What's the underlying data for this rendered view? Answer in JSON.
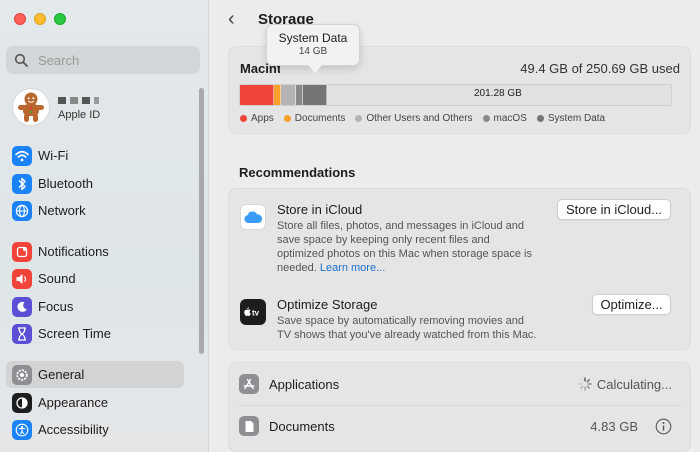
{
  "sidebar": {
    "search_placeholder": "Search",
    "account": {
      "subtitle": "Apple ID"
    },
    "items": [
      {
        "label": "Wi-Fi",
        "icon": "wifi-icon",
        "color": "#1a82fb"
      },
      {
        "label": "Bluetooth",
        "icon": "bluetooth-icon",
        "color": "#1a82fb"
      },
      {
        "label": "Network",
        "icon": "globe-icon",
        "color": "#1a82fb"
      },
      {
        "label": "Notifications",
        "icon": "bell-icon",
        "color": "#f04438"
      },
      {
        "label": "Sound",
        "icon": "speaker-icon",
        "color": "#f04438"
      },
      {
        "label": "Focus",
        "icon": "moon-icon",
        "color": "#5b4fd6"
      },
      {
        "label": "Screen Time",
        "icon": "hourglass-icon",
        "color": "#5b4fd6"
      },
      {
        "label": "General",
        "icon": "gear-icon",
        "color": "#8e8e93",
        "active": true
      },
      {
        "label": "Appearance",
        "icon": "appearance-icon",
        "color": "#1d1d1f"
      },
      {
        "label": "Accessibility",
        "icon": "accessibility-icon",
        "color": "#1a82fb"
      }
    ]
  },
  "main": {
    "title": "Storage",
    "storage": {
      "label": "Macintosh HD",
      "used": "49.4 GB of 250.69 GB used",
      "free": "201.28 GB",
      "segments": [
        {
          "name": "Apps",
          "color": "#f04438",
          "fraction": 0.08
        },
        {
          "name": "Documents",
          "color": "#f7a12a",
          "fraction": 0.016
        },
        {
          "name": "Other Users and Others",
          "color": "#b3b3b3",
          "fraction": 0.035
        },
        {
          "name": "macOS",
          "color": "#8a8a8a",
          "fraction": 0.015
        },
        {
          "name": "System Data",
          "color": "#757575",
          "fraction": 0.056
        }
      ],
      "legend": [
        {
          "label": "Apps",
          "color": "#f04438"
        },
        {
          "label": "Documents",
          "color": "#f7a12a"
        },
        {
          "label": "Other Users and Others",
          "color": "#b3b3b3"
        },
        {
          "label": "macOS",
          "color": "#8a8a8a"
        },
        {
          "label": "System Data",
          "color": "#757575"
        }
      ],
      "tooltip": {
        "title": "System Data",
        "value": "14 GB"
      }
    },
    "recommendations": {
      "title": "Recommendations",
      "items": [
        {
          "name": "Store in iCloud",
          "desc": "Store all files, photos, and messages in iCloud and save space by keeping only recent files and optimized photos on this Mac when storage space is needed.",
          "link": "Learn more...",
          "button": "Store in iCloud...",
          "icon": "icloud-icon"
        },
        {
          "name": "Optimize Storage",
          "desc": "Save space by automatically removing movies and TV shows that you've already watched from this Mac.",
          "button": "Optimize...",
          "icon": "apple-tv-icon"
        }
      ]
    },
    "categories": [
      {
        "label": "Applications",
        "value": "Calculating...",
        "icon": "app-store-icon"
      },
      {
        "label": "Documents",
        "value": "4.83 GB",
        "icon": "document-icon"
      }
    ]
  }
}
